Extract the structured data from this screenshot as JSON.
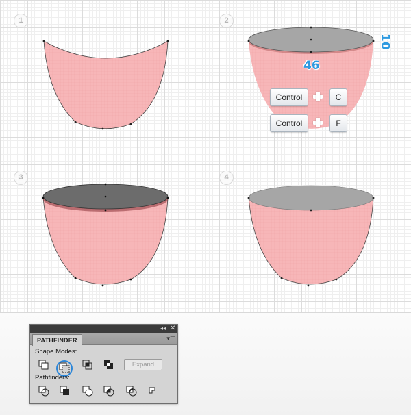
{
  "steps": [
    "1",
    "2",
    "3",
    "4"
  ],
  "dimensions": {
    "width": "46",
    "height": "10"
  },
  "shortcuts": [
    {
      "modifier": "Control",
      "key": "C"
    },
    {
      "modifier": "Control",
      "key": "F"
    }
  ],
  "colors": {
    "cup_fill": "#f7b6b8",
    "ellipse_gray": "#a6a6a6",
    "ellipse_dark": "#6c6c6c",
    "dimension_blue": "#2e9ae0",
    "highlight_blue": "#2b86d9"
  },
  "panel": {
    "title": "PATHFINDER",
    "collapse_icon": "double-chevron-left-icon",
    "close_icon": "close-icon",
    "menu_icon": "panel-menu-icon",
    "shape_modes_label": "Shape Modes:",
    "pathfinders_label": "Pathfinders:",
    "expand_label": "Expand",
    "shape_modes": [
      "unite-icon",
      "minus-front-icon",
      "intersect-icon",
      "exclude-icon"
    ],
    "selected_shape_mode": "minus-front-icon",
    "pathfinders": [
      "divide-icon",
      "trim-icon",
      "merge-icon",
      "crop-icon",
      "outline-icon",
      "minus-back-icon"
    ]
  }
}
